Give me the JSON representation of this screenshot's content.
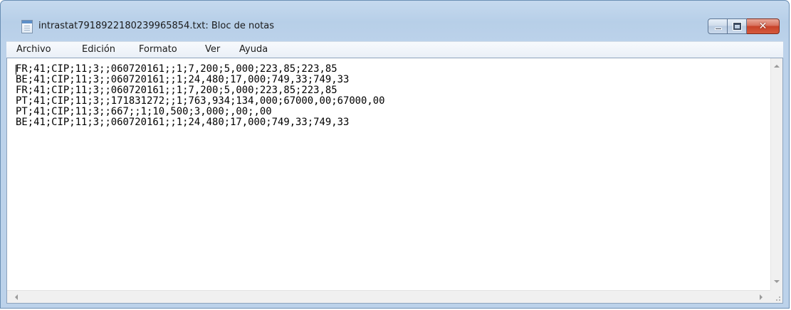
{
  "window": {
    "title": "intrastat7918922180239965854.txt: Bloc de notas",
    "close_glyph": "✕"
  },
  "menu": {
    "items": [
      "Archivo",
      "Edición",
      "Formato",
      "Ver",
      "Ayuda"
    ]
  },
  "editor": {
    "lines": [
      "FR;41;CIP;11;3;;060720161;;1;7,200;5,000;223,85;223,85",
      "BE;41;CIP;11;3;;060720161;;1;24,480;17,000;749,33;749,33",
      "FR;41;CIP;11;3;;060720161;;1;7,200;5,000;223,85;223,85",
      "PT;41;CIP;11;3;;171831272;;1;763,934;134,000;67000,00;67000,00",
      "PT;41;CIP;11;3;;667;;1;10,500;3,000;,00;,00",
      "BE;41;CIP;11;3;;060720161;;1;24,480;17,000;749,33;749,33"
    ]
  },
  "icons": {
    "app": "notepad-icon",
    "minimize": "minimize-icon",
    "maximize": "maximize-icon",
    "close": "close-icon"
  }
}
